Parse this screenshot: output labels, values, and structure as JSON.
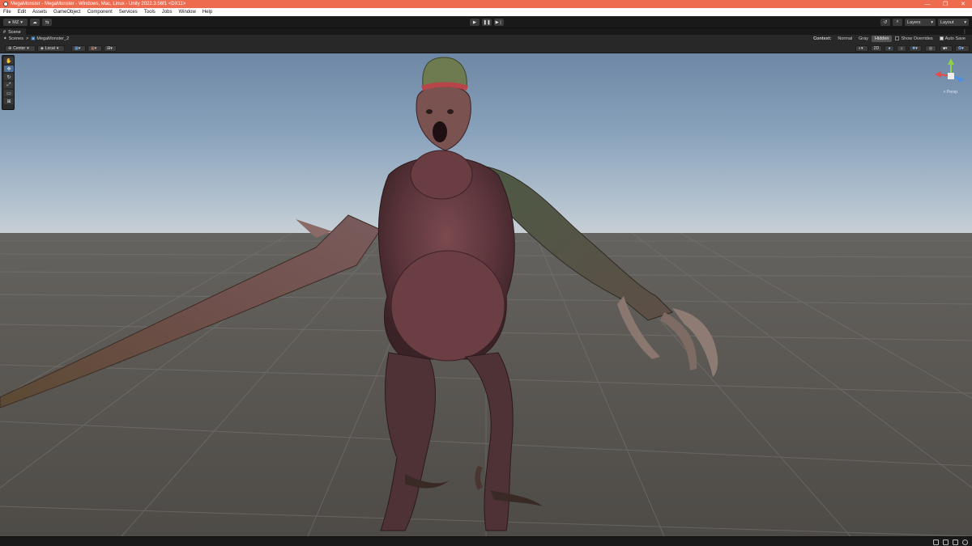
{
  "window": {
    "title": "MegaMonster - MegaMonster - Windows, Mac, Linux - Unity 2022.3.56f1 <DX11>",
    "controls": [
      "—",
      "❐",
      "✕"
    ]
  },
  "menu": [
    "File",
    "Edit",
    "Assets",
    "GameObject",
    "Component",
    "Services",
    "Tools",
    "Jobs",
    "Window",
    "Help"
  ],
  "toolbar": {
    "account_label": "MZ",
    "layers_label": "Layers",
    "layout_label": "Layout",
    "more_label": "⋮"
  },
  "tab": {
    "label": "Scene"
  },
  "breadcrumb": {
    "root": "Scenes",
    "separator": ">",
    "current": "MegaMonster_2"
  },
  "context": {
    "label": "Context:",
    "modes": [
      "Normal",
      "Gray",
      "Hidden"
    ],
    "selected": "Hidden",
    "show_overrides": "Show Overrides",
    "auto_save": "Auto Save"
  },
  "scene_toolbar": {
    "pivot": "Center",
    "space": "Local",
    "mode_2d": "2D"
  },
  "gizmo": {
    "projection_label": "< Persp"
  },
  "colors": {
    "title_bar": "#ef6b4f",
    "sky_top": "#6d87a5",
    "horizon": "#c9d0d5",
    "ground": "#5c5955",
    "gizmo_x": "#e84b4b",
    "gizmo_y": "#8fd14a",
    "gizmo_z": "#4a8fe8"
  }
}
